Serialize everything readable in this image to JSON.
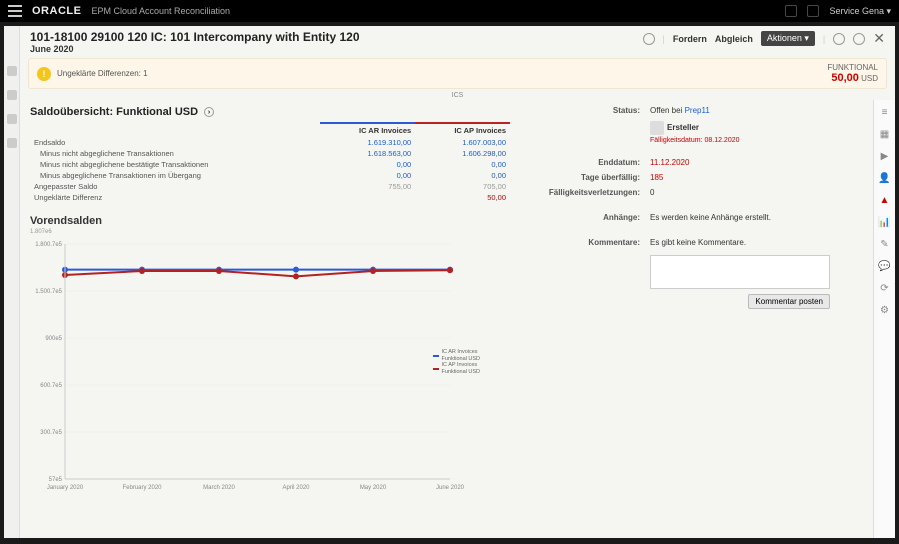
{
  "topbar": {
    "brand": "ORACLE",
    "app": "EPM Cloud Account Reconciliation",
    "user": "Service Gena ▾"
  },
  "header": {
    "title": "101-18100 29100 120 IC: 101 Intercompany with Entity 120",
    "period": "June 2020",
    "actions": {
      "fordern": "Fordern",
      "abgleich": "Abgleich",
      "aktionen": "Aktionen ▾"
    }
  },
  "warning": {
    "text": "Ungeklärte Differenzen: 1",
    "funk_label": "FUNKTIONAL",
    "funk_amount": "50,00",
    "funk_ccy": "USD"
  },
  "balance": {
    "title": "Saldoübersicht: Funktional USD",
    "col_ar": "IC AR Invoices",
    "col_ap": "IC AP Invoices",
    "rows": [
      {
        "label": "Endsaldo",
        "ar": "1.619.310,00",
        "ap": "1.607.003,00",
        "cls": "blue",
        "indent": 0
      },
      {
        "label": "Minus nicht abgeglichene Transaktionen",
        "ar": "1.618.563,00",
        "ap": "1.606.298,00",
        "cls": "blue",
        "indent": 1
      },
      {
        "label": "Minus nicht abgeglichene bestätigte Transaktionen",
        "ar": "0,00",
        "ap": "0,00",
        "cls": "blue",
        "indent": 1
      },
      {
        "label": "Minus abgeglichene Transaktionen im Übergang",
        "ar": "0,00",
        "ap": "0,00",
        "cls": "blue",
        "indent": 1
      },
      {
        "label": "Angepasster Saldo",
        "ar": "755,00",
        "ap": "705,00",
        "cls": "gray",
        "indent": 0
      },
      {
        "label": "Ungeklärte Differenz",
        "ar": "",
        "ap": "50,00",
        "cls": "red",
        "indent": 0
      }
    ]
  },
  "chart_data": {
    "type": "line",
    "title": "Vorendsalden",
    "sub": "1.807e6",
    "categories": [
      "January 2020",
      "February 2020",
      "March 2020",
      "April 2020",
      "May 2020",
      "June 2020"
    ],
    "series": [
      {
        "name": "IC AR Invoices Funktional USD",
        "color": "#2a5bd7",
        "values": [
          1610000,
          1610000,
          1610000,
          1610000,
          1610000,
          1610000
        ]
      },
      {
        "name": "IC AP Invoices Funktional USD",
        "color": "#b22222",
        "values": [
          1570000,
          1600000,
          1600000,
          1560000,
          1600000,
          1605000
        ]
      }
    ],
    "yticks": [
      "57e5",
      "300.7e5",
      "600.7e5",
      "900e5",
      "1.500.7e5",
      "1.800.7e5"
    ],
    "ylim": [
      57000,
      1800000
    ]
  },
  "details": {
    "status_label": "Status:",
    "status_val": "Offen bei",
    "status_user": "Prep11",
    "ersteller_label": "Ersteller",
    "ersteller_sub": "Fälligkeitsdatum: 08.12.2020",
    "enddatum_label": "Enddatum:",
    "enddatum_val": "11.12.2020",
    "tage_label": "Tage überfällig:",
    "tage_val": "185",
    "verletz_label": "Fälligkeitsverletzungen:",
    "verletz_val": "0",
    "anhange_label": "Anhänge:",
    "anhange_val": "Es werden keine Anhänge erstellt.",
    "komm_label": "Kommentare:",
    "komm_val": "Es gibt keine Kommentare.",
    "post_btn": "Kommentar posten"
  },
  "center_badge": "ICS"
}
